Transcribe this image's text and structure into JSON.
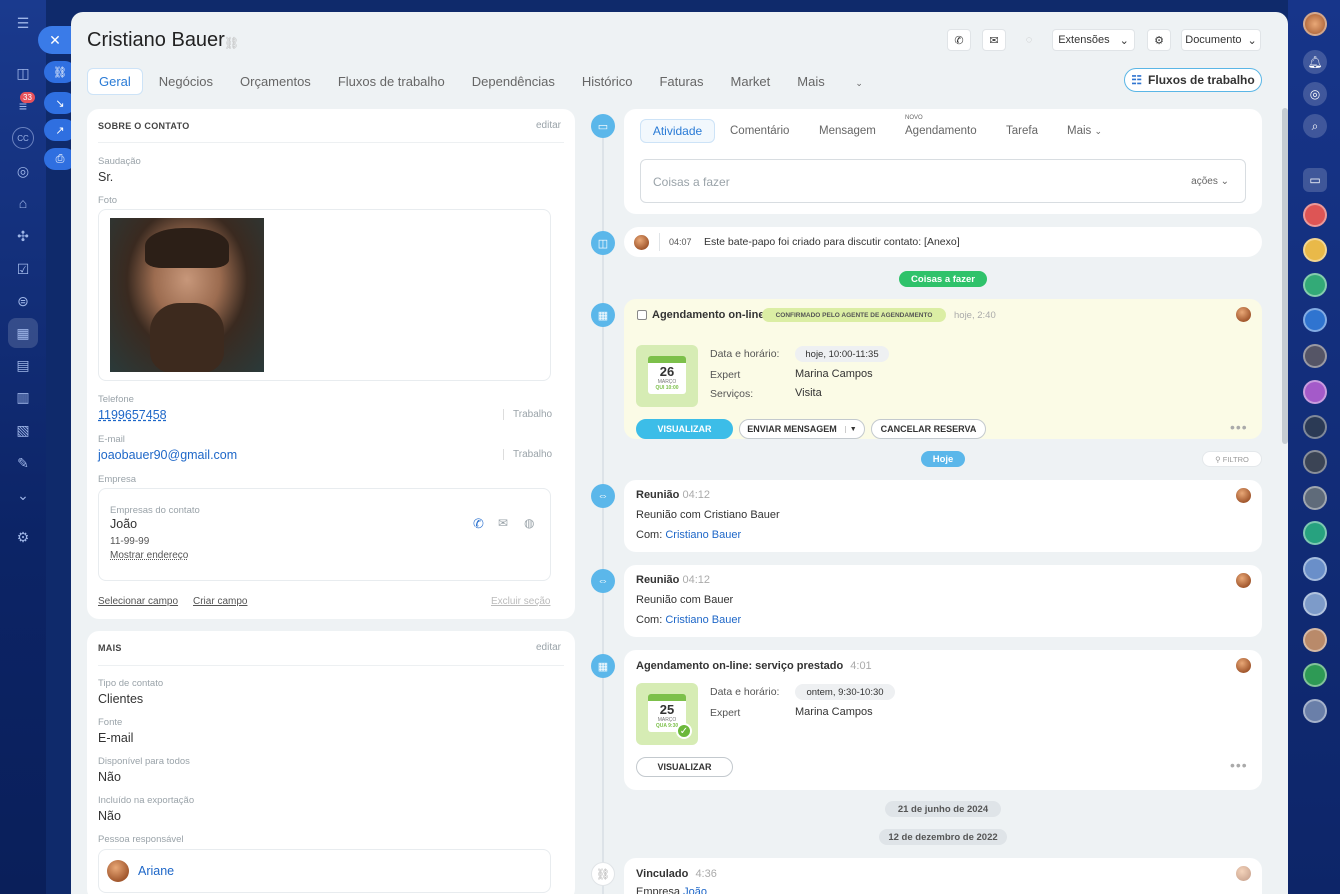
{
  "contact": {
    "name": "Cristiano Bauer"
  },
  "topbar": {
    "extensions": "Extensões",
    "document": "Documento"
  },
  "tabs": [
    "Geral",
    "Negócios",
    "Orçamentos",
    "Fluxos de trabalho",
    "Dependências",
    "Histórico",
    "Faturas",
    "Market",
    "Mais"
  ],
  "flux_button": "Fluxos de trabalho",
  "sidebar": {
    "counter": "33",
    "avatar_initials": "CC"
  },
  "about": {
    "header": "SOBRE O CONTATO",
    "edit": "editar",
    "salutation_label": "Saudação",
    "salutation": "Sr.",
    "photo_label": "Foto",
    "phone_label": "Telefone",
    "phone": "1199657458",
    "phone_type": "Trabalho",
    "email_label": "E-mail",
    "email": "joaobauer90@gmail.com",
    "email_type": "Trabalho",
    "company_label": "Empresa",
    "company_sub": "Empresas do contato",
    "company_name": "João",
    "company_phone": "11-99-99",
    "show_address": "Mostrar endereço",
    "select_field": "Selecionar campo",
    "create_field": "Criar campo",
    "delete_section": "Excluir seção"
  },
  "more": {
    "header": "MAIS",
    "edit": "editar",
    "contact_type_label": "Tipo de contato",
    "contact_type": "Clientes",
    "source_label": "Fonte",
    "source": "E-mail",
    "available_label": "Disponível para todos",
    "available": "Não",
    "export_label": "Incluído na exportação",
    "export": "Não",
    "responsible_label": "Pessoa responsável",
    "responsible": "Ariane"
  },
  "activity": {
    "tabs": [
      "Atividade",
      "Comentário",
      "Mensagem",
      "Agendamento",
      "Tarefa",
      "Mais"
    ],
    "new_badge": "NOVO",
    "placeholder": "Coisas a fazer",
    "actions": "ações"
  },
  "chat": {
    "time": "04:07",
    "text": "Este bate-papo foi criado para discutir contato: [Anexo]"
  },
  "todo_pill": "Coisas a fazer",
  "booking1": {
    "title": "Agendamento on-line",
    "badge": "CONFIRMADO PELO AGENTE DE AGENDAMENTO",
    "when": "hoje, 2:40",
    "day": "26",
    "month": "MARÇO",
    "weekday": "QUI 10:00",
    "date_label": "Data e horário:",
    "date_value": "hoje, 10:00-11:35",
    "expert_label": "Expert",
    "expert": "Marina Campos",
    "services_label": "Serviços:",
    "services": "Visita",
    "btn_view": "VISUALIZAR",
    "btn_message": "ENVIAR MENSAGEM",
    "btn_cancel": "CANCELAR RESERVA"
  },
  "today_pill": "Hoje",
  "filter": "FILTRO",
  "meeting1": {
    "title": "Reunião",
    "time": "04:12",
    "link": "Reunião com Cristiano Bauer",
    "with_label": "Com:",
    "with": "Cristiano Bauer"
  },
  "meeting2": {
    "title": "Reunião",
    "time": "04:12",
    "link": "Reunião com Bauer",
    "with_label": "Com:",
    "with": "Cristiano Bauer"
  },
  "booking2": {
    "title": "Agendamento on-line: serviço prestado",
    "time": "4:01",
    "day": "25",
    "month": "MARÇO",
    "weekday": "QUA 9:30",
    "date_label": "Data e horário:",
    "date_value": "ontem, 9:30-10:30",
    "expert_label": "Expert",
    "expert": "Marina Campos",
    "btn_view": "VISUALIZAR"
  },
  "date_pill1": "21 de junho de 2024",
  "date_pill2": "12 de dezembro de 2022",
  "linked": {
    "title": "Vinculado",
    "time": "4:36",
    "company_label": "Empresa",
    "company": "João"
  }
}
